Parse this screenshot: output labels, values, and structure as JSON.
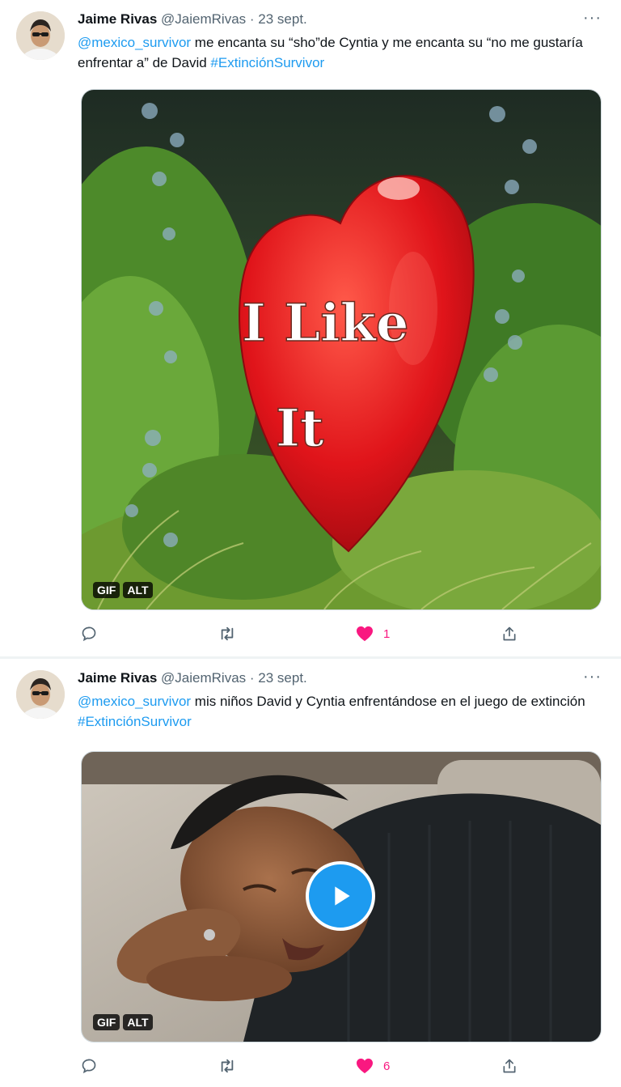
{
  "tweets": [
    {
      "author": {
        "name": "Jaime Rivas",
        "handle": "@JaiemRivas"
      },
      "separator": "·",
      "date": "23 sept.",
      "more": "···",
      "text": {
        "mention": "@mexico_survivor",
        "body": " me encanta su “sho”de Cyntia y me encanta su “no me gustaría enfrentar a” de David ",
        "hashtag": "#ExtinciónSurvivor"
      },
      "media": {
        "type": "gif",
        "overlay_text": [
          "I Like",
          "It"
        ],
        "badges": [
          "GIF",
          "ALT"
        ]
      },
      "actions": {
        "reply": "",
        "retweet": "",
        "likes": "1",
        "share": ""
      }
    },
    {
      "author": {
        "name": "Jaime Rivas",
        "handle": "@JaiemRivas"
      },
      "separator": "·",
      "date": "23 sept.",
      "more": "···",
      "text": {
        "mention": "@mexico_survivor",
        "body": " mis niños David y Cyntia enfrentándose en el juego de extinción ",
        "hashtag": "#ExtinciónSurvivor"
      },
      "media": {
        "type": "gif",
        "badges": [
          "GIF",
          "ALT"
        ]
      },
      "actions": {
        "reply": "",
        "retweet": "",
        "likes": "6",
        "share": ""
      }
    }
  ],
  "colors": {
    "link": "#1d9bf0",
    "like": "#f91880",
    "muted": "#536471"
  },
  "icons": [
    "reply-icon",
    "retweet-icon",
    "heart-icon",
    "share-icon",
    "play-icon",
    "more-icon"
  ]
}
